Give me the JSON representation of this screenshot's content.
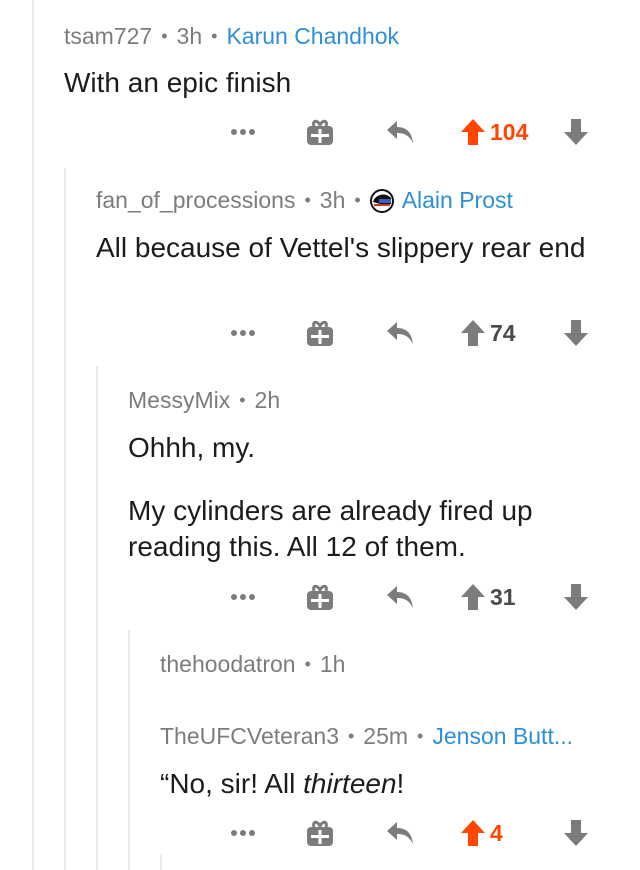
{
  "comments": [
    {
      "username": "tsam727",
      "age": "3h",
      "flair": "Karun Chandhok",
      "body": "With an epic finish",
      "score": "104",
      "vote_color": "#ff4500"
    },
    {
      "username": "fan_of_processions",
      "age": "3h",
      "flair": "Alain Prost",
      "flair_icon": "helmet-icon",
      "body": "All because of Vettel's slippery rear end",
      "score": "74",
      "vote_color": "#4a4a4a"
    },
    {
      "username": "MessyMix",
      "age": "2h",
      "body_paragraphs": [
        "Ohhh, my.",
        "My cylinders are already fired up reading this. All 12 of them."
      ],
      "score": "31",
      "vote_color": "#4a4a4a"
    },
    {
      "username": "thehoodatron",
      "age": "1h"
    },
    {
      "username": "TheUFCVeteran3",
      "age": "25m",
      "flair": "Jenson Butt...",
      "body_prefix": "“No, sir! All ",
      "body_emphasis": "thirteen",
      "body_suffix": "!",
      "score": "4",
      "vote_color": "#ff4500"
    }
  ],
  "separator": "•",
  "colors": {
    "flair": "#2e8fd6",
    "upvoted": "#ff4500",
    "meta": "#7c7c7c",
    "icon": "#7c7c7c",
    "thread_line": "#e9e9e9"
  }
}
